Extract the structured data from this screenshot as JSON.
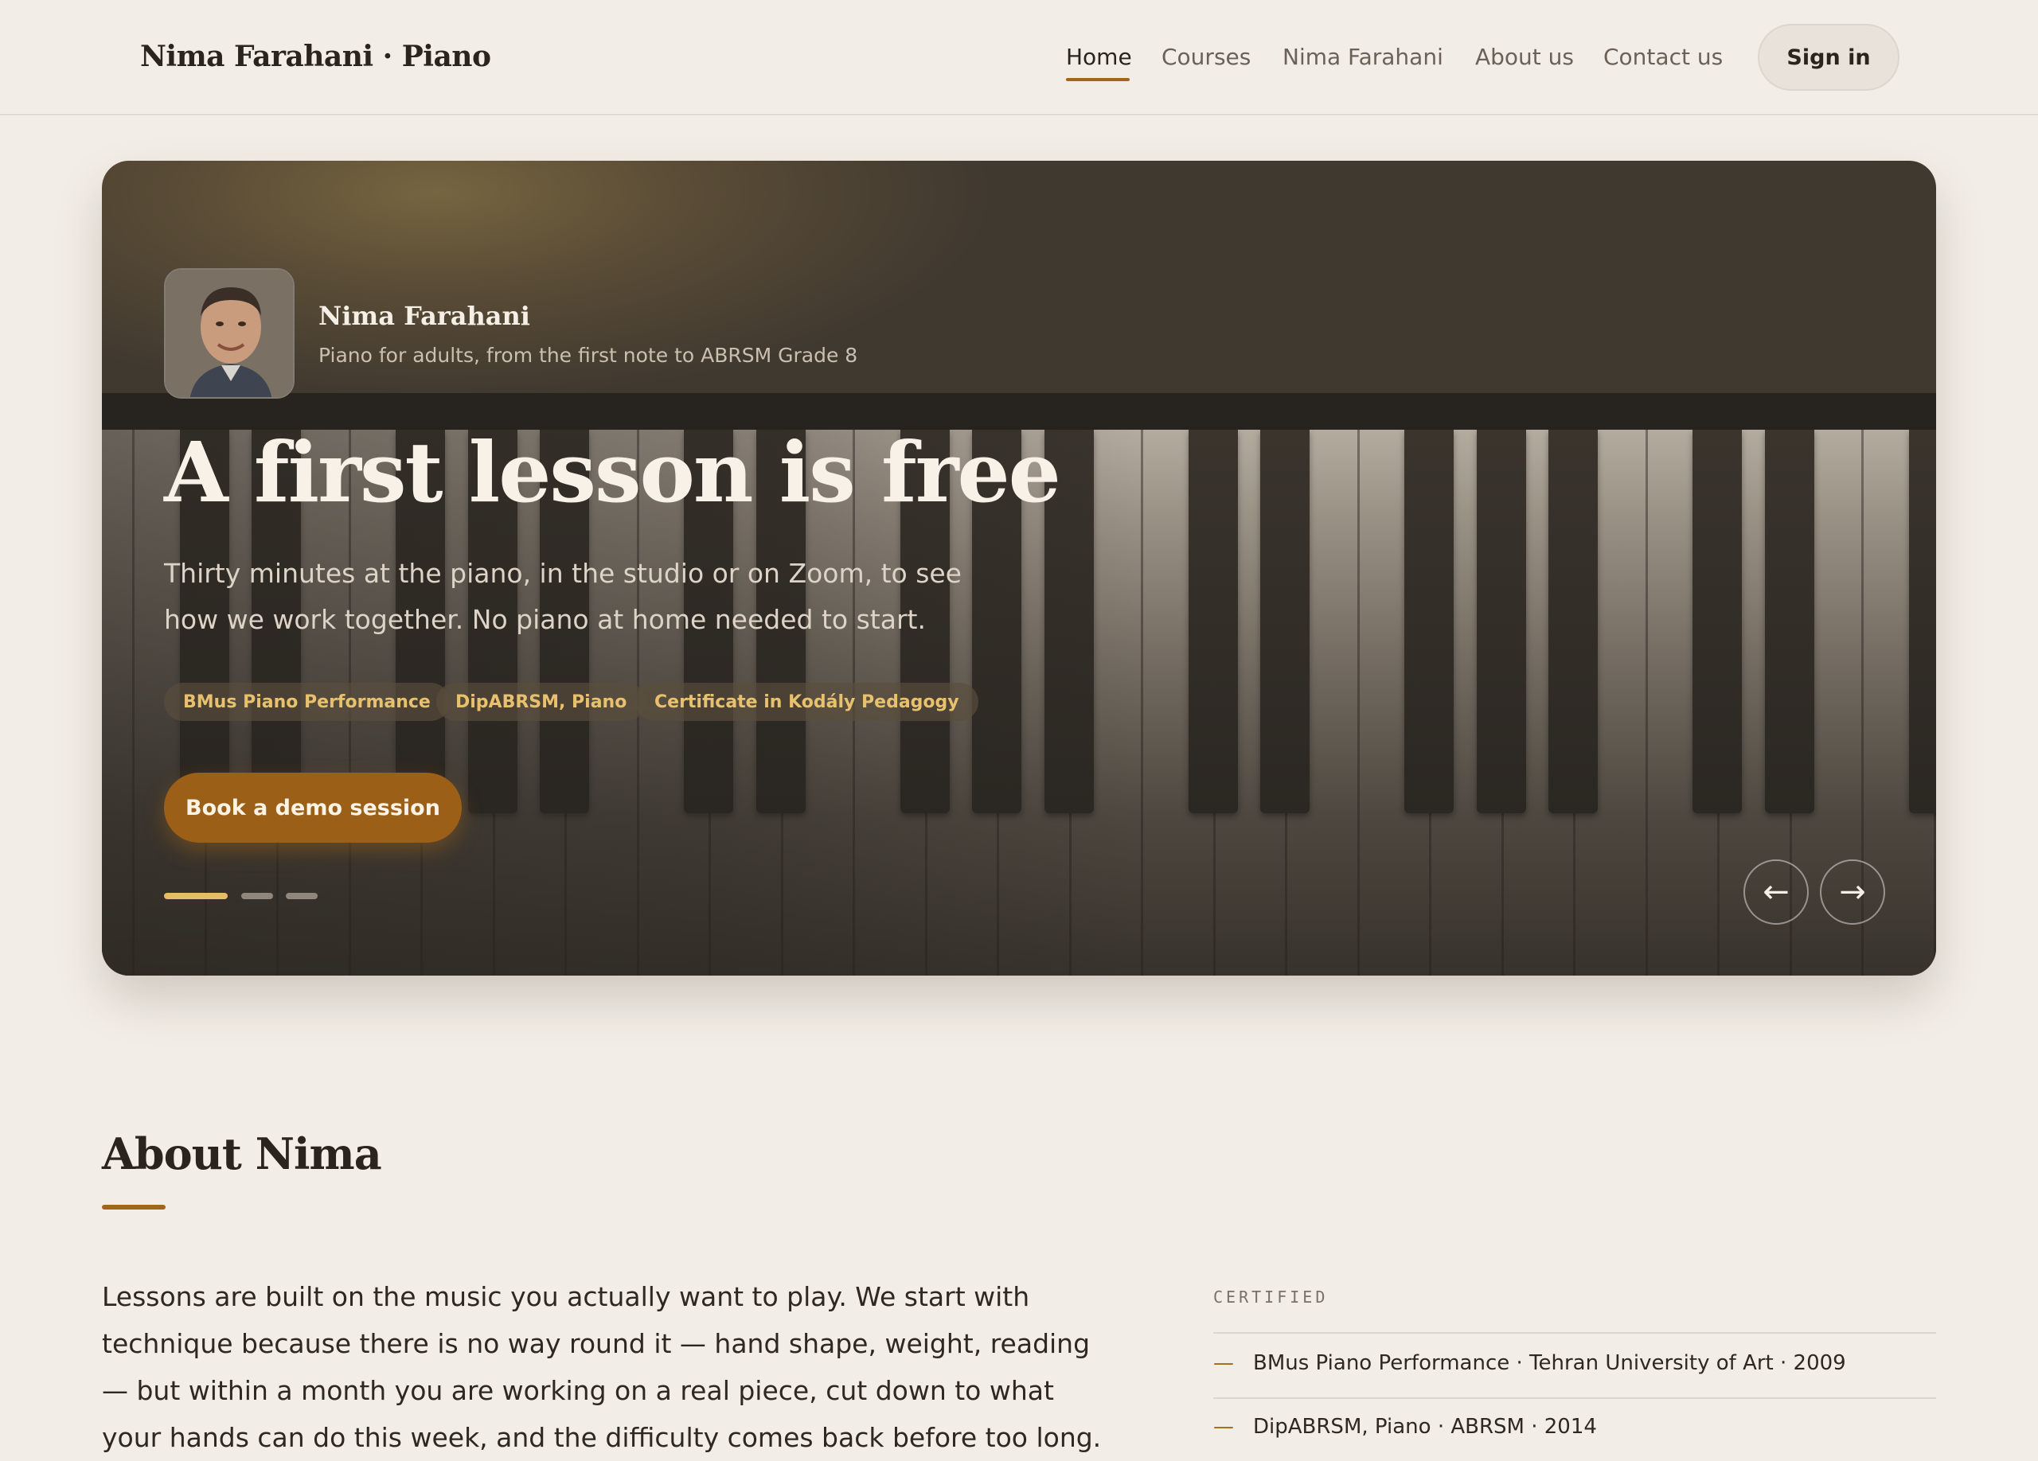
{
  "header": {
    "brand": "Nima Farahani · Piano",
    "nav": [
      "Home",
      "Courses",
      "Nima Farahani",
      "About us",
      "Contact us"
    ],
    "active_nav": "Home",
    "signin_label": "Sign in"
  },
  "hero": {
    "teacher_name": "Nima Farahani",
    "teacher_tagline": "Piano for adults, from the first note to ABRSM Grade 8",
    "title": "A first lesson is free",
    "subtitle": "Thirty minutes at the piano, in the studio or on Zoom, to see how we work together. No piano at home needed to start.",
    "chips": [
      "BMus Piano Performance",
      "DipABRSM, Piano",
      "Certificate in Kodály Pedagogy"
    ],
    "cta_label": "Book a demo session",
    "slide_count": 3,
    "active_slide": 1,
    "prev_icon": "←",
    "next_icon": "→"
  },
  "about": {
    "title": "About Nima",
    "body": "Lessons are built on the music you actually want to play. We start with technique because there is no way round it — hand shape, weight, reading — but within a month you are working on a real piece, cut down to what your hands can do this week, and the difficulty comes back before too long.",
    "certified_label": "CERTIFIED",
    "certs": [
      "BMus Piano Performance · Tehran University of Art · 2009",
      "DipABRSM, Piano · ABRSM · 2014"
    ],
    "cert_dash": "—"
  },
  "colors": {
    "accent": "#a3651c",
    "background": "#f2ede6",
    "chip_text": "#e8c16f"
  }
}
